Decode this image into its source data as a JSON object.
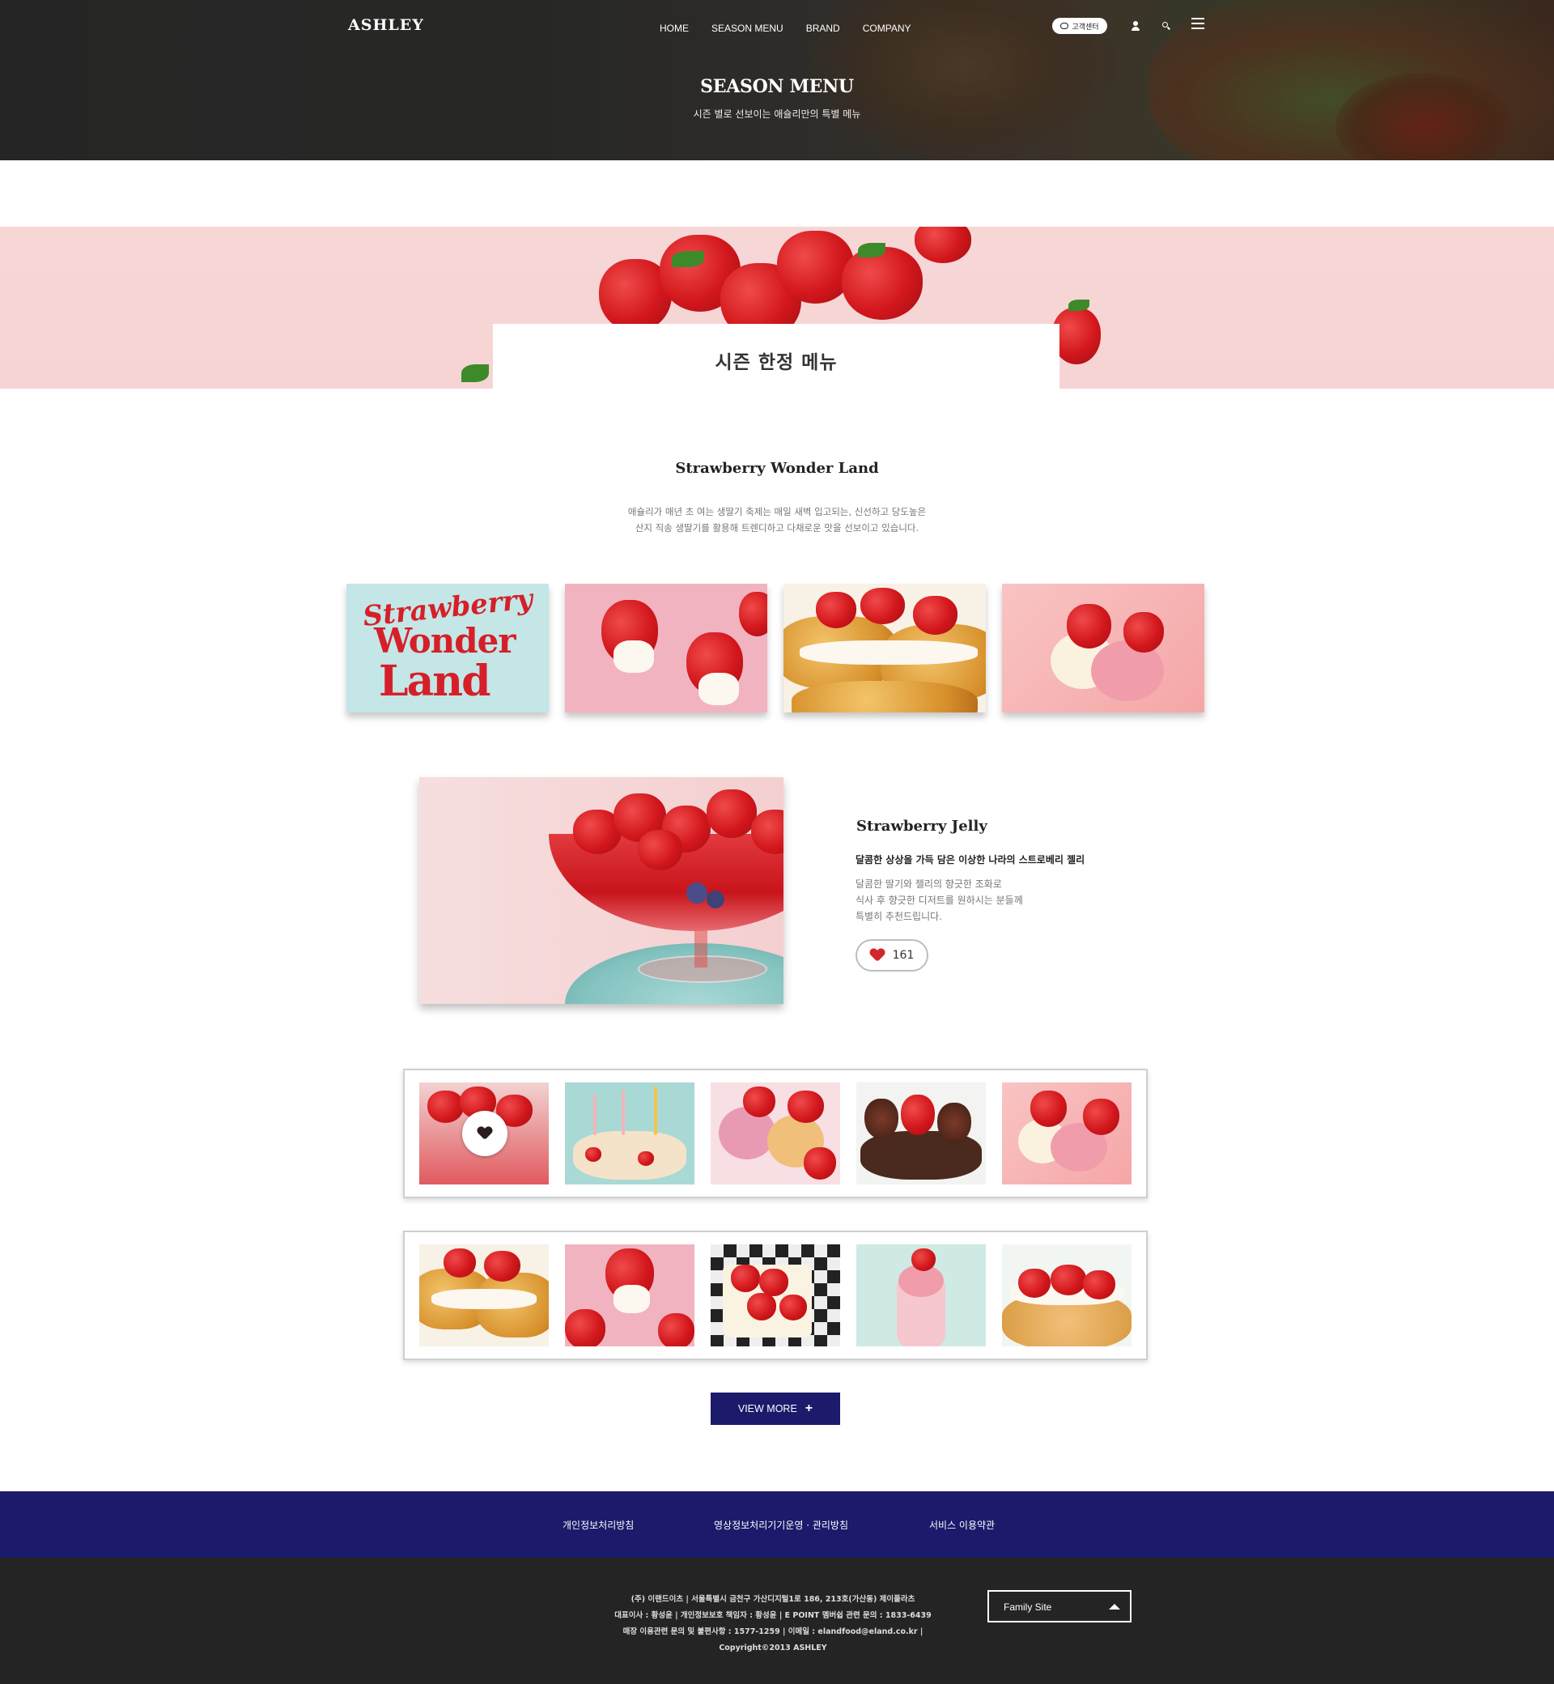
{
  "header": {
    "logo": "ASHLEY",
    "nav": [
      "HOME",
      "SEASON MENU",
      "BRAND",
      "COMPANY"
    ],
    "customer_center": "고객센터",
    "icons": [
      "user-icon",
      "search-icon",
      "menu-icon"
    ]
  },
  "hero": {
    "title": "SEASON MENU",
    "subtitle": "시즌 별로 선보이는 애슐리만의 특별 메뉴"
  },
  "banner": {
    "title": "시즌 한정 메뉴"
  },
  "section": {
    "title": "Strawberry Wonder Land",
    "desc_line1": "애슐리가 매년 초 여는 생딸기 축제는 매일 새벽 입고되는, 신선하고 당도높은",
    "desc_line2": "산지 직송 생딸기를 활용해 트렌디하고 다채로운 맛을 선보이고 있습니다."
  },
  "promo_thumb": {
    "line1": "Strawberry",
    "line2": "Wonder",
    "line3": "Land"
  },
  "feature": {
    "title": "Strawberry Jelly",
    "subtitle": "달콤한 상상을 가득 담은 이상한 나라의 스트로베리 젤리",
    "desc_line1": "달콤한 딸기와 젤리의 향긋한 조화로",
    "desc_line2": "식사 후 향긋한 디저트를 원하시는 분들께",
    "desc_line3": "특별히 추천드립니다.",
    "likes": "161"
  },
  "view_more": "VIEW MORE",
  "footer": {
    "links": [
      "개인정보처리방침",
      "영상정보처리기기운영 · 관리방침",
      "서비스 이용약관"
    ],
    "info_line1": "(주) 이랜드이츠 | 서울특별시 금천구 가산디지털1로 186, 213호(가산동) 제이플라츠",
    "info_line2": "대표이사 : 황성윤 | 개인정보보호 책임자 : 황성윤 | E POINT 멤버쉽 관련 문의 : 1833-6439",
    "info_line3": "매장 이용관련 문의 및 불편사항 : 1577-1259 | 이메일 : elandfood@eland.co.kr |",
    "copyright": "Copyright©2013 ASHLEY",
    "family_site": "Family Site"
  },
  "colors": {
    "navy": "#1b1a6b",
    "footer_dark": "#242424",
    "banner_pink": "#f6d7d6",
    "heart_red": "#d1262b"
  }
}
